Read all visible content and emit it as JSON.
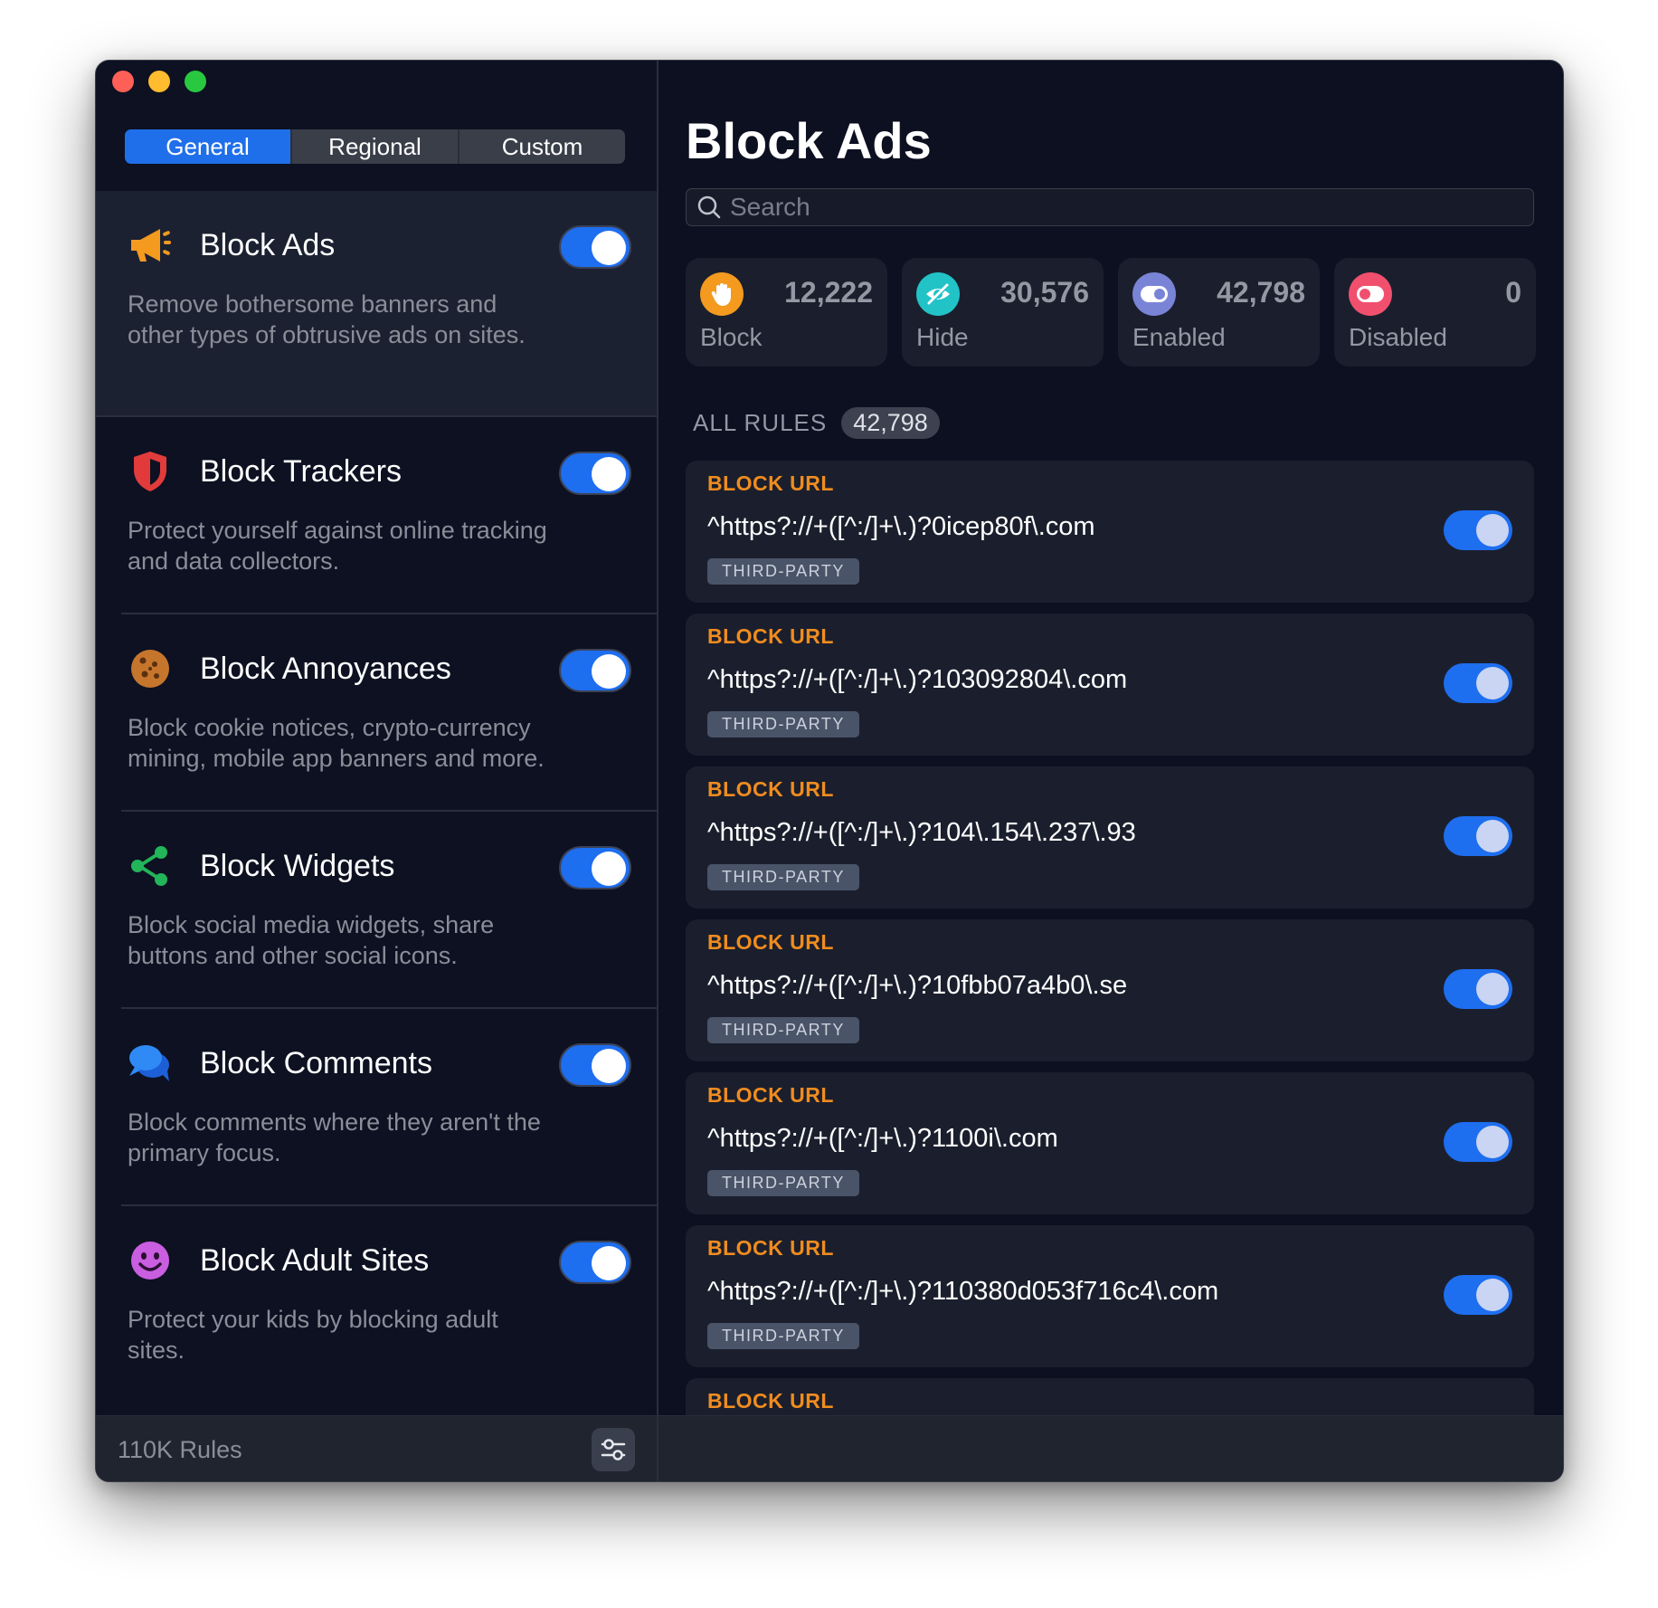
{
  "tabs": [
    {
      "label": "General",
      "active": true
    },
    {
      "label": "Regional",
      "active": false
    },
    {
      "label": "Custom",
      "active": false
    }
  ],
  "categories": [
    {
      "title": "Block Ads",
      "desc": "Remove bothersome banners and other types of obtrusive ads on sites.",
      "icon": "megaphone-icon",
      "enabled": true
    },
    {
      "title": "Block Trackers",
      "desc": "Protect yourself against online tracking and data collectors.",
      "icon": "shield-icon",
      "enabled": true
    },
    {
      "title": "Block Annoyances",
      "desc": "Block cookie notices, crypto-currency mining, mobile app banners and more.",
      "icon": "cookie-icon",
      "enabled": true
    },
    {
      "title": "Block Widgets",
      "desc": "Block social media widgets, share buttons and other social icons.",
      "icon": "share-icon",
      "enabled": true
    },
    {
      "title": "Block Comments",
      "desc": "Block comments where they aren't the primary focus.",
      "icon": "comments-icon",
      "enabled": true
    },
    {
      "title": "Block Adult Sites",
      "desc": "Protect your kids by blocking adult sites.",
      "icon": "smiley-icon",
      "enabled": true
    }
  ],
  "footer": {
    "rules_count": "110K Rules",
    "settings_icon": "sliders-icon"
  },
  "main": {
    "title": "Block Ads",
    "search_placeholder": "Search",
    "stats": [
      {
        "value": "12,222",
        "label": "Block",
        "icon": "hand-icon",
        "color": "#f39a1f"
      },
      {
        "value": "30,576",
        "label": "Hide",
        "icon": "eye-slash-icon",
        "color": "#22c3c6"
      },
      {
        "value": "42,798",
        "label": "Enabled",
        "icon": "toggle-on-icon",
        "color": "#7a84d6"
      },
      {
        "value": "0",
        "label": "Disabled",
        "icon": "toggle-off-icon",
        "color": "#f0506e"
      }
    ],
    "all_rules_label": "ALL RULES",
    "all_rules_count": "42,798",
    "rules": [
      {
        "type": "BLOCK URL",
        "url": "^https?://+([^:/]+\\.)?0icep80f\\.com",
        "tag": "THIRD-PARTY",
        "enabled": true
      },
      {
        "type": "BLOCK URL",
        "url": "^https?://+([^:/]+\\.)?103092804\\.com",
        "tag": "THIRD-PARTY",
        "enabled": true
      },
      {
        "type": "BLOCK URL",
        "url": "^https?://+([^:/]+\\.)?104\\.154\\.237\\.93",
        "tag": "THIRD-PARTY",
        "enabled": true
      },
      {
        "type": "BLOCK URL",
        "url": "^https?://+([^:/]+\\.)?10fbb07a4b0\\.se",
        "tag": "THIRD-PARTY",
        "enabled": true
      },
      {
        "type": "BLOCK URL",
        "url": "^https?://+([^:/]+\\.)?1100i\\.com",
        "tag": "THIRD-PARTY",
        "enabled": true
      },
      {
        "type": "BLOCK URL",
        "url": "^https?://+([^:/]+\\.)?110380d053f716c4\\.com",
        "tag": "THIRD-PARTY",
        "enabled": true
      },
      {
        "type": "BLOCK URL",
        "url": "",
        "tag": "",
        "enabled": true
      }
    ]
  },
  "colors": {
    "accent": "#1f6fea",
    "background": "#0c1020",
    "rule_type": "#f08c1e"
  }
}
